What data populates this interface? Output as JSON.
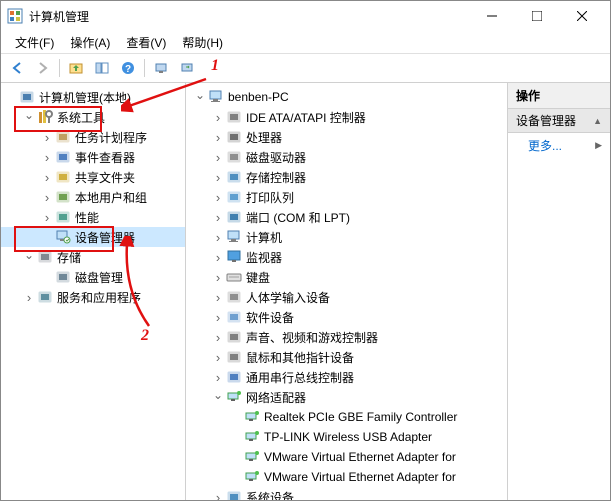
{
  "window": {
    "title": "计算机管理"
  },
  "menu": [
    "文件(F)",
    "操作(A)",
    "查看(V)",
    "帮助(H)"
  ],
  "actions": {
    "header": "操作",
    "sub": "设备管理器",
    "more": "更多..."
  },
  "annotations": {
    "one": "1",
    "two": "2"
  },
  "leftTree": [
    {
      "d": 0,
      "exp": "",
      "icon": "mgmt",
      "label": "计算机管理(本地)"
    },
    {
      "d": 1,
      "exp": "v",
      "icon": "tools",
      "label": "系统工具",
      "box": true
    },
    {
      "d": 2,
      "exp": ">",
      "icon": "sched",
      "label": "任务计划程序"
    },
    {
      "d": 2,
      "exp": ">",
      "icon": "event",
      "label": "事件查看器"
    },
    {
      "d": 2,
      "exp": ">",
      "icon": "share",
      "label": "共享文件夹"
    },
    {
      "d": 2,
      "exp": ">",
      "icon": "users",
      "label": "本地用户和组"
    },
    {
      "d": 2,
      "exp": ">",
      "icon": "perf",
      "label": "性能"
    },
    {
      "d": 2,
      "exp": "",
      "icon": "devmgr",
      "label": "设备管理器",
      "box": true,
      "selected": true
    },
    {
      "d": 1,
      "exp": "v",
      "icon": "storage",
      "label": "存储"
    },
    {
      "d": 2,
      "exp": "",
      "icon": "disk",
      "label": "磁盘管理"
    },
    {
      "d": 1,
      "exp": ">",
      "icon": "services",
      "label": "服务和应用程序"
    }
  ],
  "midTree": [
    {
      "d": 0,
      "exp": "v",
      "icon": "pc",
      "label": "benben-PC"
    },
    {
      "d": 1,
      "exp": ">",
      "icon": "ide",
      "label": "IDE ATA/ATAPI 控制器"
    },
    {
      "d": 1,
      "exp": ">",
      "icon": "cpu",
      "label": "处理器"
    },
    {
      "d": 1,
      "exp": ">",
      "icon": "disc",
      "label": "磁盘驱动器"
    },
    {
      "d": 1,
      "exp": ">",
      "icon": "stor",
      "label": "存储控制器"
    },
    {
      "d": 1,
      "exp": ">",
      "icon": "print",
      "label": "打印队列"
    },
    {
      "d": 1,
      "exp": ">",
      "icon": "port",
      "label": "端口 (COM 和 LPT)"
    },
    {
      "d": 1,
      "exp": ">",
      "icon": "pc",
      "label": "计算机"
    },
    {
      "d": 1,
      "exp": ">",
      "icon": "monitor",
      "label": "监视器"
    },
    {
      "d": 1,
      "exp": ">",
      "icon": "keyboard",
      "label": "键盘"
    },
    {
      "d": 1,
      "exp": ">",
      "icon": "hid",
      "label": "人体学输入设备"
    },
    {
      "d": 1,
      "exp": ">",
      "icon": "soft",
      "label": "软件设备"
    },
    {
      "d": 1,
      "exp": ">",
      "icon": "sound",
      "label": "声音、视频和游戏控制器"
    },
    {
      "d": 1,
      "exp": ">",
      "icon": "mouse",
      "label": "鼠标和其他指针设备"
    },
    {
      "d": 1,
      "exp": ">",
      "icon": "usb",
      "label": "通用串行总线控制器"
    },
    {
      "d": 1,
      "exp": "v",
      "icon": "net",
      "label": "网络适配器"
    },
    {
      "d": 2,
      "exp": "",
      "icon": "net",
      "label": "Realtek PCIe GBE Family Controller"
    },
    {
      "d": 2,
      "exp": "",
      "icon": "net",
      "label": "TP-LINK Wireless USB Adapter"
    },
    {
      "d": 2,
      "exp": "",
      "icon": "net",
      "label": "VMware Virtual Ethernet Adapter for"
    },
    {
      "d": 2,
      "exp": "",
      "icon": "net",
      "label": "VMware Virtual Ethernet Adapter for"
    },
    {
      "d": 1,
      "exp": ">",
      "icon": "sys",
      "label": "系统设备"
    }
  ],
  "icons": {
    "mgmt": "#4a7fb0",
    "tools": "#d9a020",
    "sched": "#c0a060",
    "event": "#5080c0",
    "share": "#d0b040",
    "users": "#70a050",
    "perf": "#50a090",
    "devmgr": "#5090c0",
    "storage": "#808890",
    "disk": "#708898",
    "services": "#6090a0",
    "pc": "#5090d0",
    "ide": "#808080",
    "cpu": "#707070",
    "disc": "#909090",
    "stor": "#5090c0",
    "print": "#60a0d0",
    "port": "#4080b0",
    "monitor": "#50a0d0",
    "keyboard": "#808080",
    "hid": "#909090",
    "soft": "#70a0d0",
    "sound": "#808080",
    "mouse": "#808080",
    "usb": "#5080c0",
    "net": "#40a050",
    "sys": "#5090c0"
  }
}
